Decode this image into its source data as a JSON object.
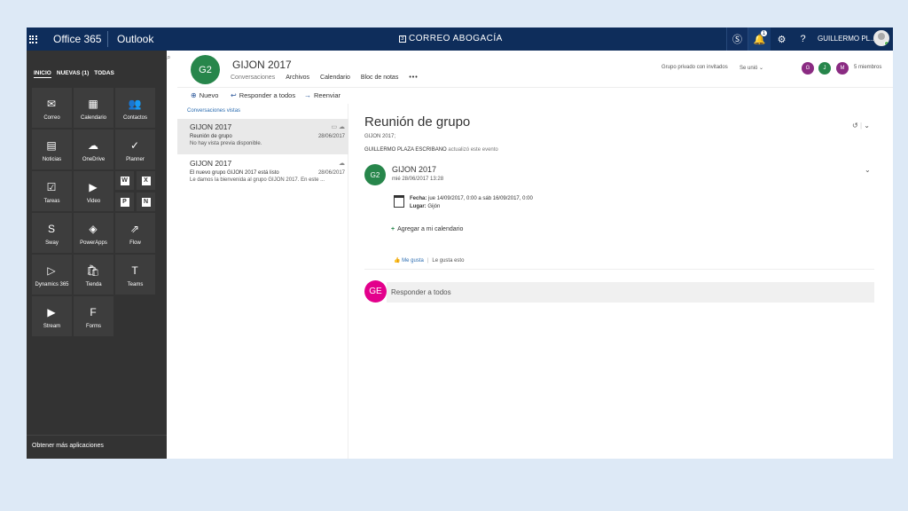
{
  "topbar": {
    "suite": "Office 365",
    "app": "Outlook",
    "brand_box": "3",
    "brand": "CORREO ABOGACÍA",
    "notification_count": "1",
    "user": "GUILLERMO PL..."
  },
  "launcher": {
    "tabs": [
      "INICIO",
      "NUEVAS (1)",
      "TODAS"
    ],
    "tiles": [
      "Correo",
      "Calendario",
      "Contactos",
      "Noticias",
      "OneDrive",
      "Planner",
      "Tareas",
      "Video",
      "Sway",
      "PowerApps",
      "Flow",
      "Dynamics 365",
      "Tienda",
      "Teams",
      "Stream",
      "Forms"
    ],
    "mini": [
      "W",
      "X",
      "P",
      "N"
    ],
    "footer": "Obtener más aplicaciones"
  },
  "group": {
    "initials": "G2",
    "name": "GIJON 2017",
    "tabs": [
      "Conversaciones",
      "Archivos",
      "Calendario",
      "Bloc de notas"
    ],
    "privacy": "Grupo privado con invitados",
    "joined": "Se unió",
    "member_initials": [
      "G",
      "J",
      "M"
    ],
    "member_colors": [
      "#8a2b82",
      "#27864b",
      "#8a2b82"
    ],
    "members": "5 miembros"
  },
  "commands": {
    "new": "Nuevo",
    "reply_all": "Responder a todos",
    "forward": "Reenviar"
  },
  "list": {
    "heading": "Conversaciones vistas",
    "items": [
      {
        "title": "GIJON 2017",
        "subject": "Reunión de grupo",
        "preview": "No hay vista previa disponible.",
        "date": "28/06/2017"
      },
      {
        "title": "GIJON 2017",
        "subject": "El nuevo grupo GIJON 2017 está listo",
        "preview": "Le damos la bienvenida al grupo GIJON 2017. En este ...",
        "date": "28/06/2017"
      }
    ]
  },
  "reading": {
    "subject": "Reunión de grupo",
    "group": "GIJON 2017;",
    "actor": "GUILLERMO PLAZA ESCRIBANO",
    "action": "actualizó este evento",
    "event": {
      "initials": "G2",
      "sender": "GIJON 2017",
      "sent": "mié 28/06/2017 13:28",
      "date_label": "Fecha:",
      "date_value": "jue 14/09/2017, 0:00 a sáb 16/09/2017, 0:00",
      "place_label": "Lugar:",
      "place_value": "Gijón",
      "add_calendar": "Agregar a mi calendario",
      "like": "Me gusta",
      "like_info": "Le gusta esto"
    },
    "reply_initials": "GE",
    "reply_placeholder": "Responder a todos"
  }
}
